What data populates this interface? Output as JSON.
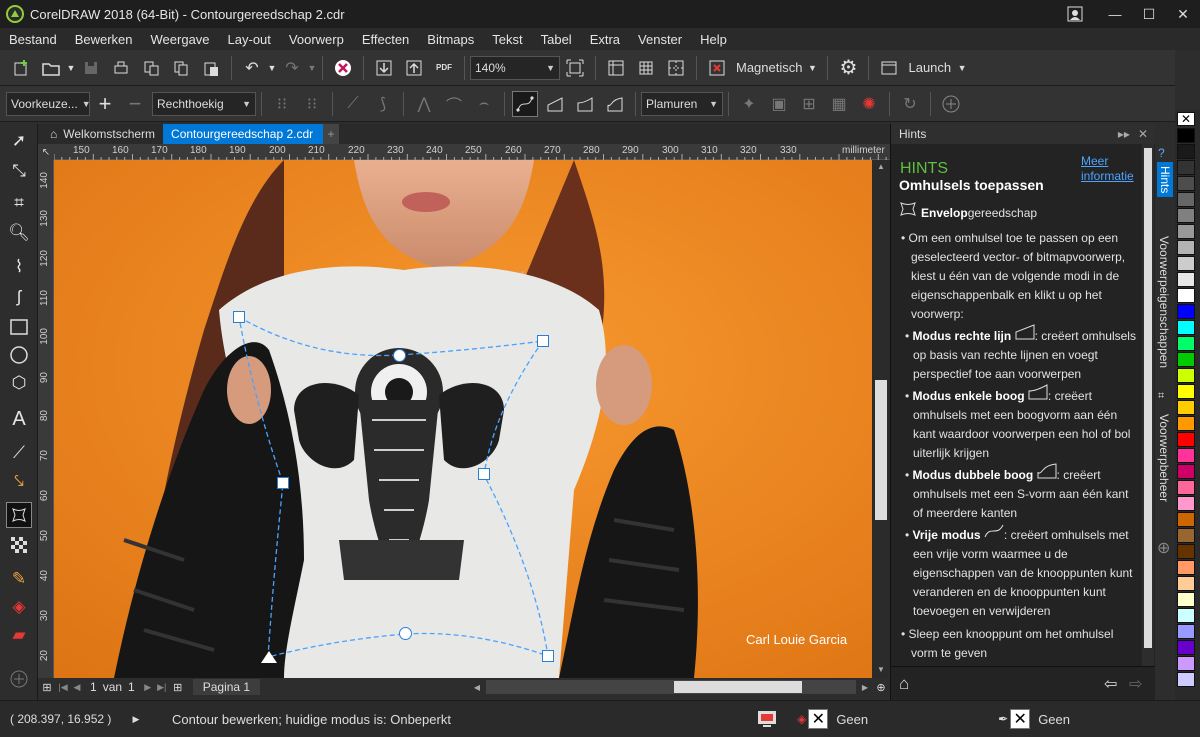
{
  "window": {
    "title": "CorelDRAW 2018 (64-Bit) - Contourgereedschap 2.cdr",
    "min": "—",
    "max": "☐",
    "close": "✕"
  },
  "menu": [
    "Bestand",
    "Bewerken",
    "Weergave",
    "Lay-out",
    "Voorwerp",
    "Effecten",
    "Bitmaps",
    "Tekst",
    "Tabel",
    "Extra",
    "Venster",
    "Help"
  ],
  "toolbar": {
    "zoom": "140%",
    "snap": "Magnetisch",
    "launch": "Launch"
  },
  "propbar": {
    "preset": "Voorkeuze...",
    "shape": "Rechthoekig",
    "mapping": "Plamuren"
  },
  "tabs": {
    "welcome": "Welkomstscherm",
    "doc": "Contourgereedschap 2.cdr",
    "add": "+"
  },
  "ruler": {
    "unit": "millimeter",
    "h": [
      "150",
      "160",
      "170",
      "180",
      "190",
      "200",
      "210",
      "220",
      "230",
      "240",
      "250",
      "260",
      "270",
      "280",
      "290",
      "300",
      "310",
      "320",
      "330"
    ],
    "v": [
      "140",
      "130",
      "120",
      "110",
      "100",
      "90",
      "80",
      "70",
      "60",
      "50",
      "40",
      "30",
      "20",
      "10"
    ]
  },
  "canvas": {
    "credit": "Carl Louie Garcia"
  },
  "pages": {
    "current": "1",
    "of": "van",
    "total": "1",
    "tab": "Pagina 1"
  },
  "status": {
    "coords": "( 208.397, 16.952 )",
    "message": "Contour bewerken;  huidige modus is: Onbeperkt",
    "fill": "Geen",
    "outline": "Geen"
  },
  "hints": {
    "panel_title": "Hints",
    "heading": "HINTS",
    "more": "Meer informatie",
    "title": "Omhulsels toepassen",
    "tool_bold": "Envelop",
    "tool_rest": "gereedschap",
    "intro": "Om een omhulsel toe te passen op een geselecteerd vector- of bitmapvoorwerp, kiest u één van de volgende modi in de eigenschappenbalk en klikt u op het voorwerp:",
    "modes": [
      {
        "name": "Modus rechte lijn",
        "desc": "creëert omhulsels op basis van rechte lijnen en voegt perspectief toe aan voorwerpen"
      },
      {
        "name": "Modus enkele boog",
        "desc": "creëert omhulsels met een boogvorm aan één kant waardoor voorwerpen een hol of bol uiterlijk krijgen"
      },
      {
        "name": "Modus dubbele boog",
        "desc": "creëert omhulsels met een S-vorm aan één kant of meerdere kanten"
      },
      {
        "name": "Vrije modus",
        "desc": "creëert omhulsels met een vrije vorm waarmee u de eigenschappen van de knooppunten kunt veranderen en de knooppunten kunt toevoegen en verwijderen"
      }
    ],
    "last": "Sleep een knooppunt om het omhulsel vorm te geven"
  },
  "sidetabs": [
    "Hints",
    "Voorwerpeigenschappen",
    "Voorwerpbeheer"
  ],
  "palette": [
    "#000000",
    "#1a1a1a",
    "#333333",
    "#4d4d4d",
    "#666666",
    "#808080",
    "#999999",
    "#b3b3b3",
    "#cccccc",
    "#e6e6e6",
    "#ffffff",
    "#0000ff",
    "#00ffff",
    "#00ff66",
    "#00cc00",
    "#ccff00",
    "#ffff00",
    "#ffcc00",
    "#ff9900",
    "#ff0000",
    "#ff3399",
    "#cc0066",
    "#ff6699",
    "#ff99cc",
    "#cc6600",
    "#996633",
    "#663300",
    "#ff9966",
    "#ffcc99",
    "#ffffcc",
    "#ccffff",
    "#9999ff",
    "#6600cc",
    "#cc99ff",
    "#ccccff"
  ],
  "colors": {
    "accent": "#0078d7",
    "hints_green": "#5fbf3f",
    "canvas_bg": "#f08a22"
  }
}
